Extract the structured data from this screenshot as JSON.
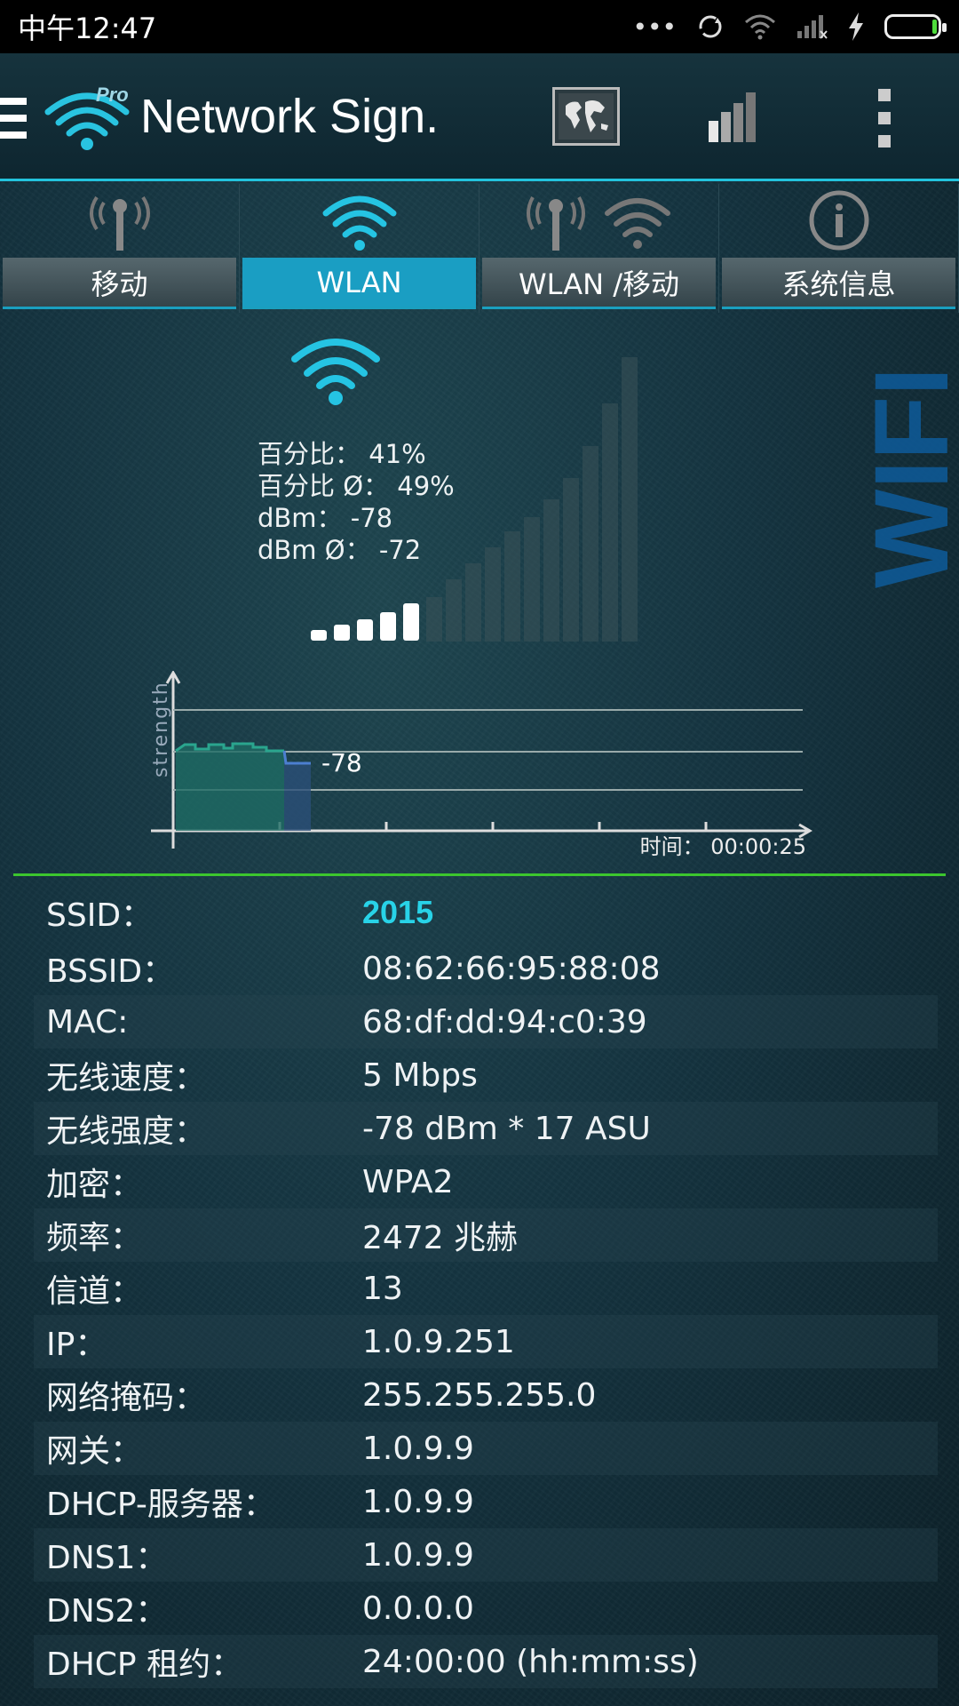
{
  "status_bar": {
    "time": "中午12:47",
    "icons": [
      "more-dots-icon",
      "sync-icon",
      "wifi-icon",
      "cell-signal-icon",
      "charging-bolt-icon",
      "battery-icon"
    ],
    "more": "•••"
  },
  "app_bar": {
    "title": "Network Sign.",
    "logo_badge": "Pro",
    "icons": [
      "menu-icon",
      "app-logo-icon",
      "map-icon",
      "signal-bars-icon",
      "overflow-menu-icon"
    ]
  },
  "tabs": [
    {
      "label": "移动",
      "icon": "cell-tower-icon",
      "active": false
    },
    {
      "label": "WLAN",
      "icon": "wifi-icon",
      "active": true
    },
    {
      "label": "WLAN /移动",
      "icon": "tower-and-wifi-icon",
      "active": false
    },
    {
      "label": "系统信息",
      "icon": "info-icon",
      "active": false
    }
  ],
  "signal": {
    "percent_line": "百分比： 41%",
    "percent_avg_line": "百分比 Ø： 49%",
    "dbm_line": "dBm： -78",
    "dbm_avg_line": "dBm Ø： -72",
    "percent": 41,
    "watermark": "WIFI"
  },
  "graph": {
    "ylabel": "strength",
    "current_value": "-78",
    "time_label": "时间： 00:00:25"
  },
  "info_rows": [
    {
      "key": "SSID：",
      "value": "2015"
    },
    {
      "key": "BSSID：",
      "value": "08:62:66:95:88:08"
    },
    {
      "key": "MAC:",
      "value": "68:df:dd:94:c0:39"
    },
    {
      "key": "无线速度：",
      "value": "5 Mbps"
    },
    {
      "key": "无线强度：",
      "value": "-78 dBm * 17 ASU"
    },
    {
      "key": "加密：",
      "value": "WPA2"
    },
    {
      "key": "频率：",
      "value": "2472 兆赫"
    },
    {
      "key": "信道：",
      "value": "13"
    },
    {
      "key": "IP：",
      "value": "1.0.9.251"
    },
    {
      "key": "网络掩码：",
      "value": "255.255.255.0"
    },
    {
      "key": "网关：",
      "value": "1.0.9.9"
    },
    {
      "key": "DHCP-服务器：",
      "value": "1.0.9.9"
    },
    {
      "key": "DNS1：",
      "value": "1.0.9.9"
    },
    {
      "key": "DNS2：",
      "value": "0.0.0.0"
    },
    {
      "key": "DHCP 租约：",
      "value": "24:00:00 (hh:mm:ss)"
    }
  ],
  "colors": {
    "accent": "#23c3dd",
    "ssid": "#28d3e8",
    "divider": "#3cc62e",
    "active_tab": "#1a9ec3"
  }
}
